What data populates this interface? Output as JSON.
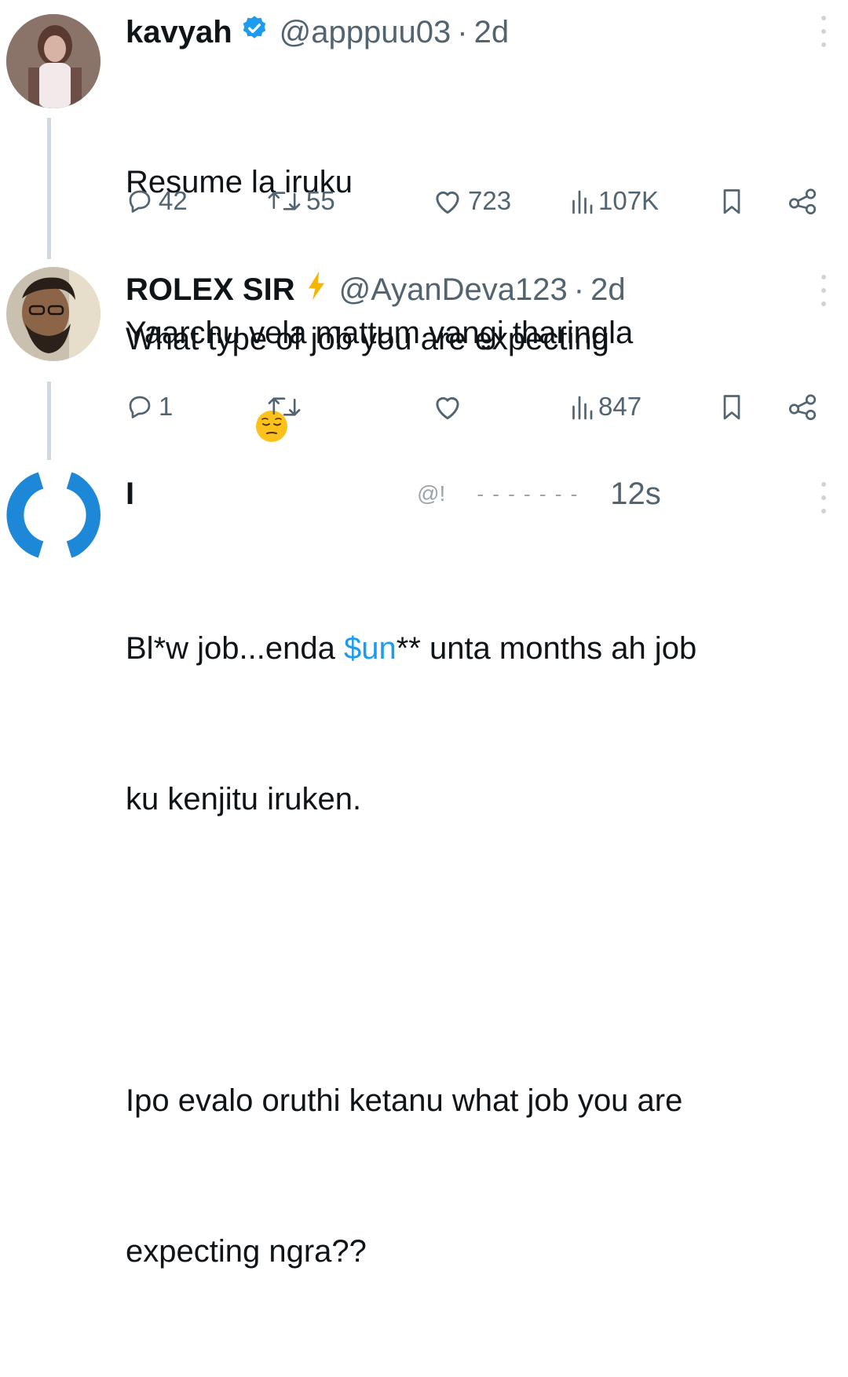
{
  "tweets": [
    {
      "name": "kavyah",
      "handle": "@apppuu03",
      "time": "2d",
      "text_lines": [
        "Resume la iruku",
        "Yaarchu vela mattum vangi tharingla"
      ],
      "emoji": "pensive-face",
      "replies": "42",
      "retweets": "55",
      "likes": "723",
      "views": "107K"
    },
    {
      "name": "ROLEX SIR",
      "handle": "@AyanDeva123",
      "time": "2d",
      "text": "What type of job you are expecting",
      "replies": "1",
      "retweets": "",
      "likes": "",
      "views": "847"
    },
    {
      "name": "I",
      "handle": "@!",
      "time": "12s",
      "text_before_link": "Bl*w job...enda ",
      "link": "$un",
      "text_after_link": "** unta months ah job",
      "line2": "ku kenjitu iruken.",
      "line3": "Ipo evalo oruthi ketanu what job you are",
      "line4": "expecting ngra??"
    }
  ],
  "colors": {
    "text": "#0f1419",
    "secondary": "#536471",
    "link": "#1d9bf0",
    "verified": "#1d9bf0",
    "lightning": "#f7b500"
  }
}
